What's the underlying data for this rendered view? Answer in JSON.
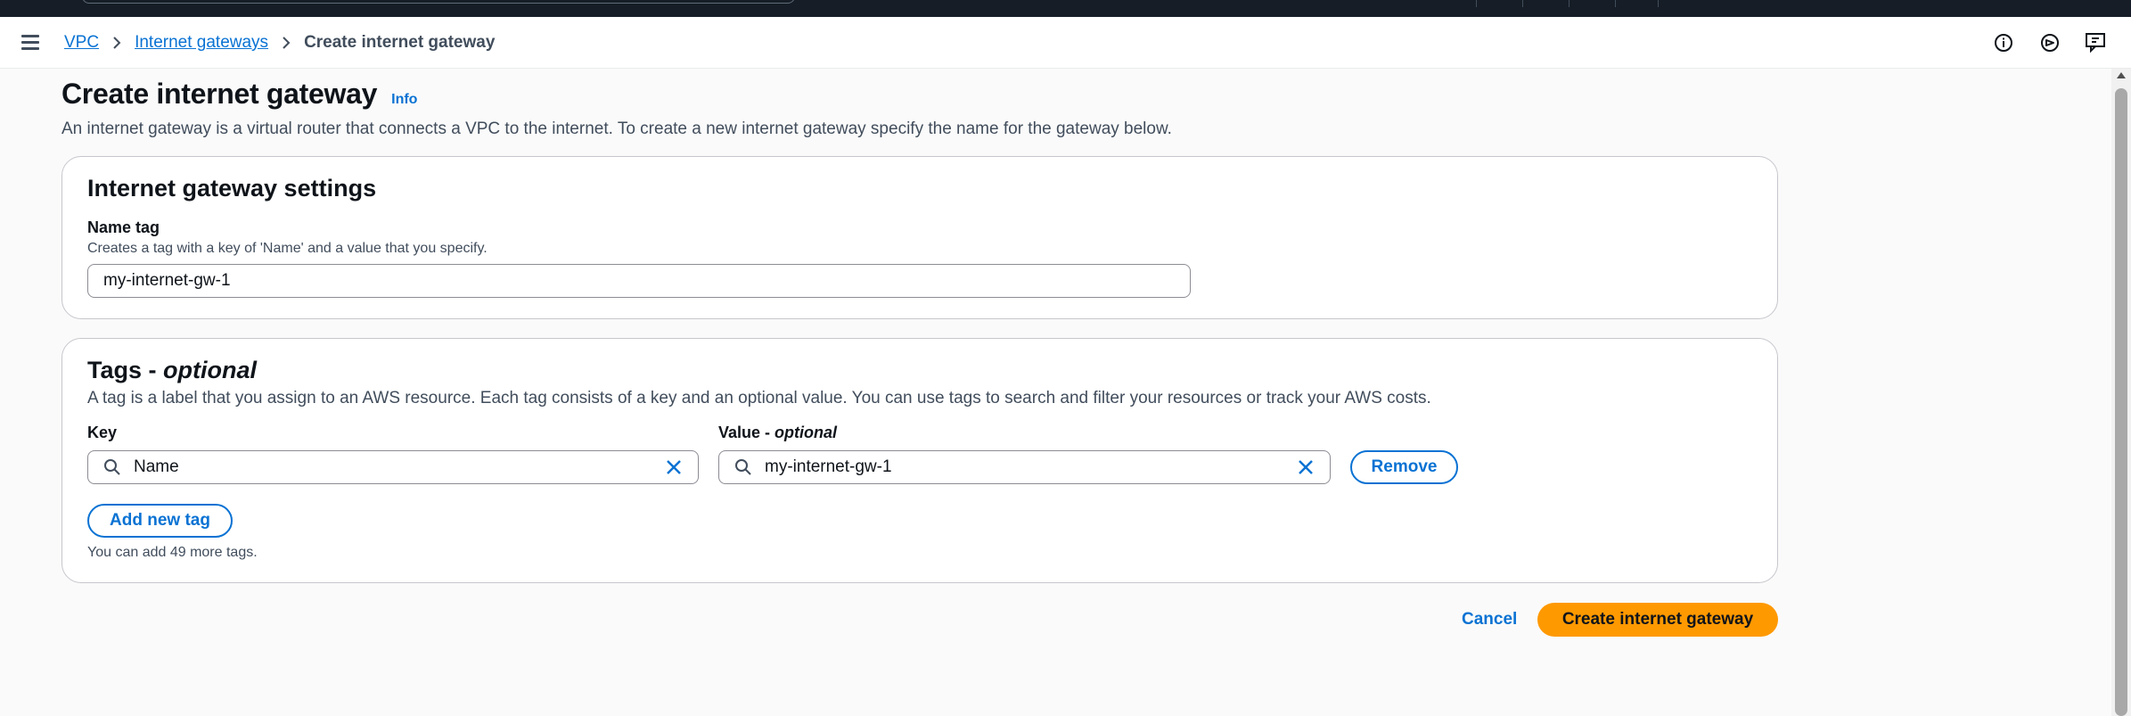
{
  "breadcrumb": {
    "items": [
      "VPC",
      "Internet gateways"
    ],
    "current": "Create internet gateway"
  },
  "page": {
    "title": "Create internet gateway",
    "info_label": "Info",
    "description": "An internet gateway is a virtual router that connects a VPC to the internet. To create a new internet gateway specify the name for the gateway below."
  },
  "settings": {
    "title": "Internet gateway settings",
    "name_tag_label": "Name tag",
    "name_tag_description": "Creates a tag with a key of 'Name' and a value that you specify.",
    "name_tag_value": "my-internet-gw-1"
  },
  "tags": {
    "title_prefix": "Tags - ",
    "title_optional": "optional",
    "description": "A tag is a label that you assign to an AWS resource. Each tag consists of a key and an optional value. You can use tags to search and filter your resources or track your AWS costs.",
    "key_label": "Key",
    "value_label_prefix": "Value - ",
    "value_label_optional": "optional",
    "rows": [
      {
        "key": "Name",
        "value": "my-internet-gw-1"
      }
    ],
    "remove_label": "Remove",
    "add_label": "Add new tag",
    "remaining_hint": "You can add 49 more tags."
  },
  "footer": {
    "cancel_label": "Cancel",
    "submit_label": "Create internet gateway"
  },
  "icons": {
    "menu": "hamburger-menu-icon",
    "breadcrumb_separator": "chevron-right-icon",
    "info": "info-icon",
    "notifications": "notifications-icon",
    "feedback": "feedback-icon",
    "search": "search-icon",
    "clear": "close-icon"
  },
  "colors": {
    "link": "#0972d3",
    "primary_button": "#ff9900",
    "top_bar": "#161d26"
  }
}
